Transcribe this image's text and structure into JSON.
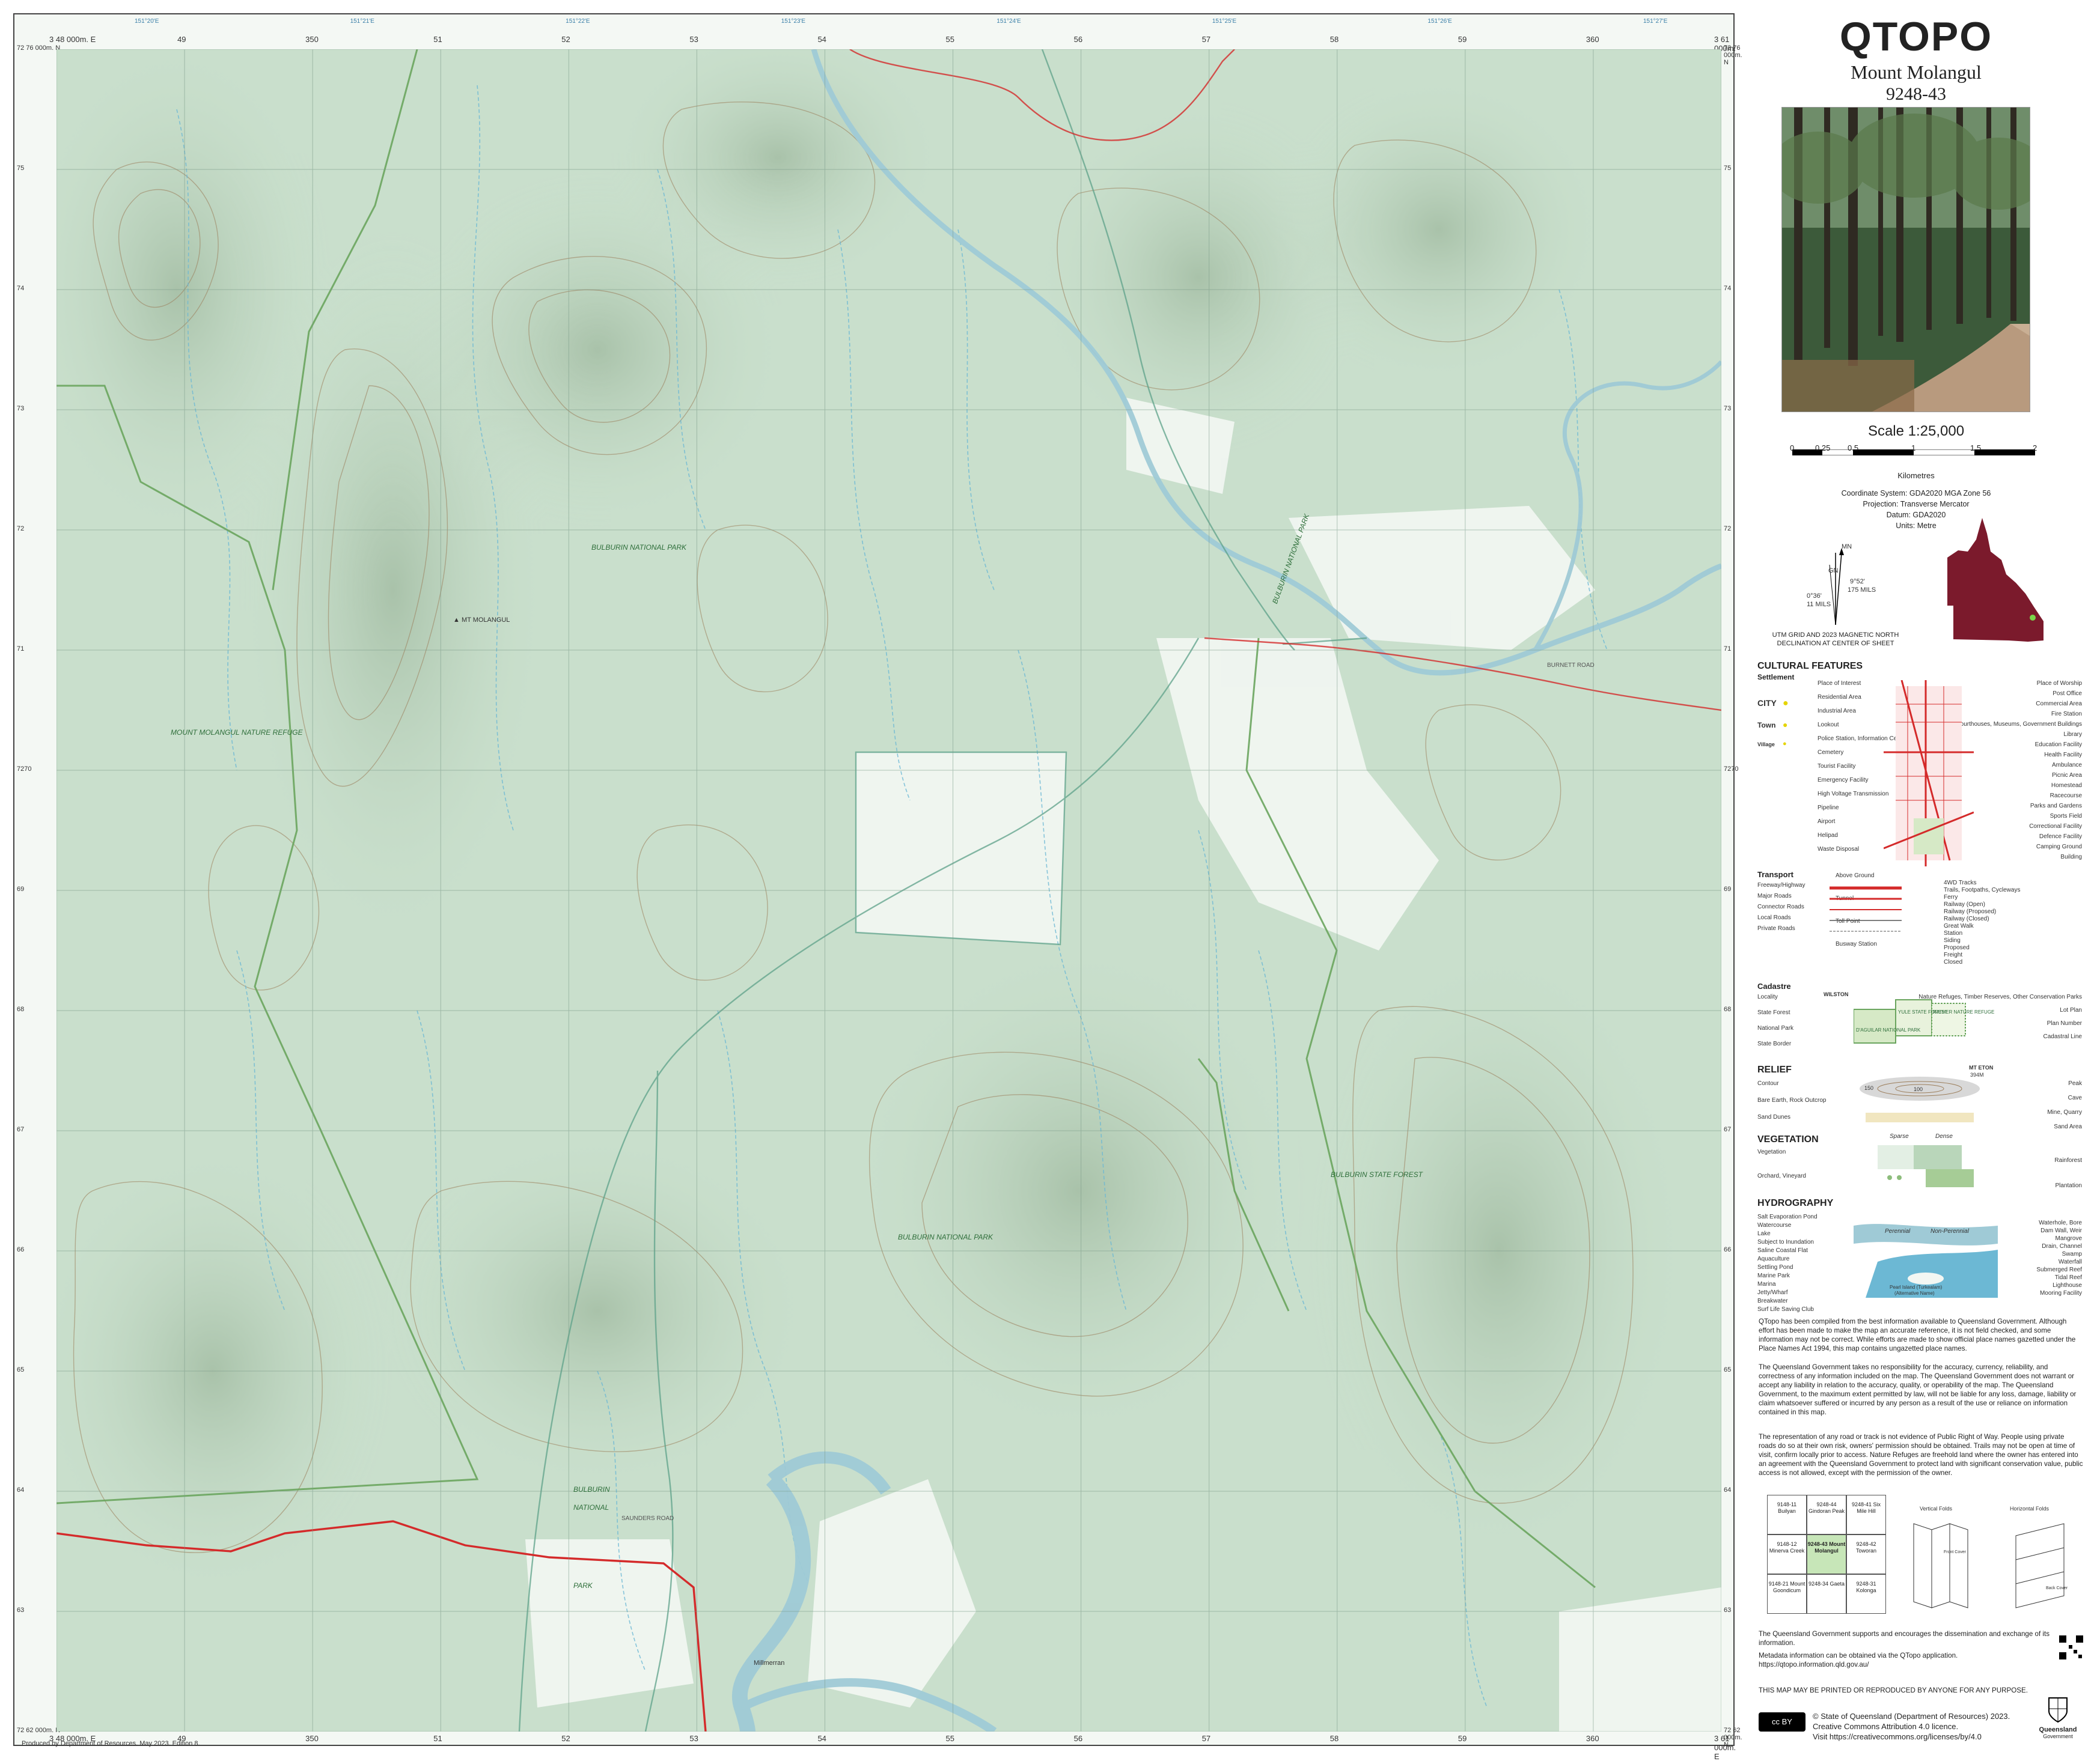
{
  "map": {
    "grid_eastings_top": [
      "3 48 000m. E",
      "49",
      "350",
      "51",
      "52",
      "53",
      "54",
      "55",
      "56",
      "57",
      "58",
      "59",
      "360",
      "3 61 000m. E"
    ],
    "grid_eastings_bottom": [
      "3 48 000m. E",
      "49",
      "350",
      "51",
      "52",
      "53",
      "54",
      "55",
      "56",
      "57",
      "58",
      "59",
      "360",
      "3 61 000m. E"
    ],
    "geo_top": [
      "151°20'E",
      "151°21'E",
      "151°22'E",
      "151°23'E",
      "151°24'E",
      "151°25'E",
      "151°26'E",
      "151°27'E"
    ],
    "grid_northings": [
      "72 76 000m. N",
      "75",
      "74",
      "73",
      "72",
      "71",
      "7270",
      "69",
      "68",
      "67",
      "66",
      "65",
      "64",
      "63",
      "72 62 000m. N"
    ],
    "place_labels": {
      "bulburin_np_1": "BULBURIN NATIONAL PARK",
      "bulburin_np_2": "BULBURIN NATIONAL PARK",
      "bulburin_np_3": "BULBURIN NATIONAL PARK",
      "bulburin_np_4": "BULBURIN",
      "bulburin_np_5": "NATIONAL",
      "bulburin_np_6": "PARK",
      "bulburin_sf": "BULBURIN STATE FOREST",
      "nature_refuge": "MOUNT MOLANGUL NATURE REFUGE",
      "mt_molangul": "MT MOLANGUL",
      "road_label": "SAUNDERS ROAD",
      "road_label_2": "BURNETT ROAD",
      "locality": "Millmerran"
    },
    "footer": "Produced by Department of Resources. May 2023. Edition 8."
  },
  "panel": {
    "brand": "QTOPO",
    "sheet_name": "Mount Molangul",
    "sheet_number": "9248-43",
    "scale": "Scale 1:25,000",
    "scale_ticks": [
      "0",
      "0.25",
      "0.5",
      "1",
      "1.5",
      "2"
    ],
    "scale_units": "Kilometres",
    "projection": [
      "Coordinate System: GDA2020 MGA Zone 56",
      "Projection: Transverse Mercator",
      "Datum: GDA2020",
      "Units: Metre"
    ],
    "declination": {
      "mn": "MN",
      "gn": "GN",
      "west": "0°36'",
      "west_mils": "11 MILS",
      "east": "9°52'",
      "east_mils": "175 MILS",
      "caption": "UTM GRID AND 2023 MAGNETIC NORTH DECLINATION AT CENTER OF SHEET"
    },
    "legend": {
      "cultural_title": "CULTURAL FEATURES",
      "settlement": "Settlement",
      "city": "CITY",
      "town": "Town",
      "village": "Village",
      "cultural_left": [
        "Place of Interest",
        "Residential Area",
        "Industrial Area",
        "Lookout",
        "Police Station, Information Centre",
        "Cemetery",
        "Tourist Facility",
        "Emergency Facility",
        "High Voltage Transmission",
        "Pipeline",
        "Airport",
        "Helipad",
        "Waste Disposal"
      ],
      "cultural_right": [
        "Place of Worship",
        "Post Office",
        "Commercial Area",
        "Fire Station",
        "Courthouses, Museums, Government Buildings",
        "Library",
        "Education Facility",
        "Health Facility",
        "Ambulance",
        "Picnic Area",
        "Homestead",
        "Racecourse",
        "Parks and Gardens",
        "Sports Field",
        "Correctional Facility",
        "Defence Facility",
        "Camping Ground",
        "Building"
      ],
      "transport_title": "Transport",
      "transport_left": [
        "Freeway/Highway",
        "Major Roads",
        "Connector Roads",
        "Local Roads",
        "Private Roads"
      ],
      "transport_mid": [
        "Above Ground",
        "Tunnel",
        "Toll Point",
        "Busway Station"
      ],
      "transport_right": [
        "4WD Tracks",
        "Trails, Footpaths, Cycleways",
        "Ferry",
        "Railway (Open)",
        "Railway (Proposed)",
        "Railway (Closed)",
        "Great Walk",
        "Station",
        "Siding",
        "Proposed",
        "Freight",
        "Closed"
      ],
      "cadastre_title": "Cadastre",
      "cadastre_left": [
        "Locality",
        "State Forest",
        "National Park",
        "State Border"
      ],
      "cadastre_right": [
        "Nature Refuges, Timber Reserves, Other Conservation Parks",
        "Lot Plan",
        "Plan Number",
        "Cadastral Line"
      ],
      "cadastre_samples": [
        "WILSTON",
        "D'AGUILAR NATIONAL PARK",
        "YULE STATE FOREST",
        "RATHER NATURE REFUGE"
      ],
      "relief_title": "RELIEF",
      "relief_left": [
        "Contour",
        "Bare Earth, Rock Outcrop",
        "Sand Dunes"
      ],
      "relief_right": [
        "Peak",
        "Cave",
        "Mine, Quarry",
        "Sand Area"
      ],
      "relief_samples": [
        "MT ETON",
        "394M",
        "100",
        "150"
      ],
      "vegetation_title": "VEGETATION",
      "vegetation_left": [
        "Vegetation",
        "Orchard, Vineyard"
      ],
      "vegetation_right": [
        "Rainforest",
        "Plantation"
      ],
      "vegetation_samples": [
        "Sparse",
        "Dense"
      ],
      "hydro_title": "HYDROGRAPHY",
      "hydro_left": [
        "Salt Evaporation Pond",
        "Watercourse",
        "Lake",
        "Subject to Inundation",
        "Saline Coastal Flat",
        "Aquaculture",
        "Settling Pond",
        "Marine Park",
        "Marina",
        "Jetty/Wharf",
        "Breakwater",
        "Surf Life Saving Club"
      ],
      "hydro_right": [
        "Waterhole, Bore",
        "Dam Wall, Weir",
        "Mangrove",
        "Drain, Channel",
        "Swamp",
        "Waterfall",
        "Submerged Reef",
        "Tidal Reef",
        "Lighthouse",
        "Mooring Facility"
      ],
      "hydro_samples": [
        "Perennial",
        "Non-Perennial",
        "Pearl Island (Turkealam)",
        "(Alternative Name)"
      ]
    },
    "disclaimer": [
      "QTopo has been compiled from the best information available to Queensland Government. Although effort has been made to make the map an accurate reference, it is not field checked, and some information may not be correct. While efforts are made to show official place names gazetted under the Place Names Act 1994, this map contains ungazetted place names.",
      "The Queensland Government takes no responsibility for the accuracy, currency, reliability, and correctness of any information included on the map. The Queensland Government does not warrant or accept any liability in relation to the accuracy, quality, or operability of the map. The Queensland Government, to the maximum extent permitted by law, will not be liable for any loss, damage, liability or claim whatsoever suffered or incurred by any person as a result of the use or reliance on information contained in this map.",
      "The representation of any road or track is not evidence of Public Right of Way. People using private roads do so at their own risk, owners' permission should be obtained. Trails may not be open at time of visit, confirm locally prior to access. Nature Refuges are freehold land where the owner has entered into an agreement with the Queensland Government to protect land with significant conservation value, public access is not allowed, except with the permission of the owner."
    ],
    "adjoining": [
      [
        "9148-11 Builyan",
        "9248-44 Gindoran Peak",
        "9248-41 Six Mile Hill"
      ],
      [
        "9148-12 Minerva Creek",
        "9248-43 Mount Molangul",
        "9248-42 Toworan"
      ],
      [
        "9148-21 Mount Goondicum",
        "9248-34 Gaeta",
        "9248-31 Kolonga"
      ]
    ],
    "folds": {
      "vertical": "Vertical Folds",
      "horizontal": "Horizontal Folds",
      "front": "Front Cover",
      "back": "Back Cover"
    },
    "support": "The Queensland Government supports and encourages the dissemination and exchange of its information.",
    "metadata": "Metadata information can be obtained via the QTopo application. https://qtopo.information.qld.gov.au/",
    "reproduce": "THIS MAP MAY BE PRINTED OR REPRODUCED BY ANYONE FOR ANY PURPOSE.",
    "copyright": [
      "© State of Queensland (Department of Resources) 2023.",
      "Creative Commons Attribution 4.0 licence.",
      "Visit https://creativecommons.org/licenses/by/4.0"
    ],
    "government": [
      "Queensland",
      "Government"
    ],
    "cc_badge": "cc BY"
  },
  "colors": {
    "forest": "#c9dfcc",
    "clearing": "#f3f7f3",
    "contour": "#9b7d5a",
    "water": "#6cb8d4",
    "river": "#9fcad6",
    "road_major": "#d42a2a",
    "park_boundary": "#6aa55e",
    "qld_maroon": "#7b1a2c"
  }
}
